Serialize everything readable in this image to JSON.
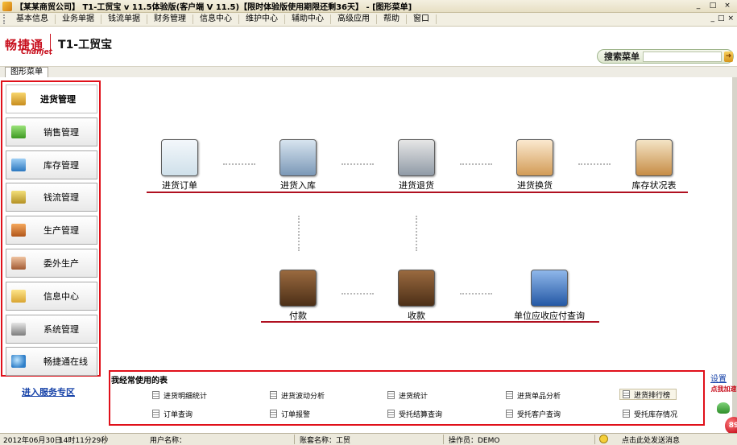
{
  "window": {
    "title": "【某某商贸公司】 T1-工贸宝 v 11.5体验版(客户端 V 11.5)【限时体验版使用期限还剩36天】 - [图形菜单]",
    "controls": [
      "_",
      "□",
      "×"
    ],
    "mdi_controls": [
      "_",
      "□",
      "×"
    ]
  },
  "menu": [
    "基本信息",
    "业务单据",
    "钱流单据",
    "财务管理",
    "信息中心",
    "维护中心",
    "辅助中心",
    "高级应用",
    "帮助",
    "窗口"
  ],
  "logo": {
    "cn": "畅捷通",
    "en": "Chanjet",
    "product": "T1-工贸宝"
  },
  "search": {
    "label": "搜索菜单",
    "placeholder": "",
    "go": "➜"
  },
  "tab": {
    "label": "图形菜单"
  },
  "sidebar": {
    "items": [
      {
        "label": "进货管理",
        "icon": "purchase-icon",
        "active": true
      },
      {
        "label": "销售管理",
        "icon": "sales-basket-icon",
        "active": false
      },
      {
        "label": "库存管理",
        "icon": "inventory-icon",
        "active": false
      },
      {
        "label": "钱流管理",
        "icon": "cash-flow-icon",
        "active": false
      },
      {
        "label": "生产管理",
        "icon": "production-icon",
        "active": false
      },
      {
        "label": "委外生产",
        "icon": "outsourcing-icon",
        "active": false
      },
      {
        "label": "信息中心",
        "icon": "info-center-icon",
        "active": false
      },
      {
        "label": "系统管理",
        "icon": "system-settings-icon",
        "active": false
      },
      {
        "label": "畅捷通在线",
        "icon": "online-globe-icon",
        "active": false
      }
    ],
    "service_link": "进入服务专区"
  },
  "flow": {
    "row1": [
      {
        "label": "进货订单",
        "icon": "purchase-order-icon"
      },
      {
        "label": "进货入库",
        "icon": "stock-in-icon"
      },
      {
        "label": "进货退货",
        "icon": "purchase-return-icon"
      },
      {
        "label": "进货换货",
        "icon": "purchase-exchange-icon"
      },
      {
        "label": "库存状况表",
        "icon": "stock-status-icon"
      }
    ],
    "row2": [
      {
        "label": "付款",
        "icon": "payment-chest-icon"
      },
      {
        "label": "收款",
        "icon": "receipt-chest-icon"
      },
      {
        "label": "单位应收应付查询",
        "icon": "receivable-query-icon"
      }
    ]
  },
  "common_tables": {
    "title": "我经常使用的表",
    "settings": "设置",
    "items": [
      "进货明细统计",
      "进货波动分析",
      "进货统计",
      "进货单品分析",
      "进货排行榜",
      "订单查询",
      "订单报警",
      "受托结算查询",
      "受托客户查询",
      "受托库存情况"
    ],
    "highlighted": "进货排行榜"
  },
  "float_widget": {
    "tag": "点我加速",
    "badge": "89"
  },
  "status": {
    "date": "2012年06月30日",
    "time": "14时11分29秒",
    "user_label": "用户名称：",
    "account_label": "账套名称：工贸",
    "operator": "操作员：DEMO",
    "message": "点击此处发送消息"
  }
}
